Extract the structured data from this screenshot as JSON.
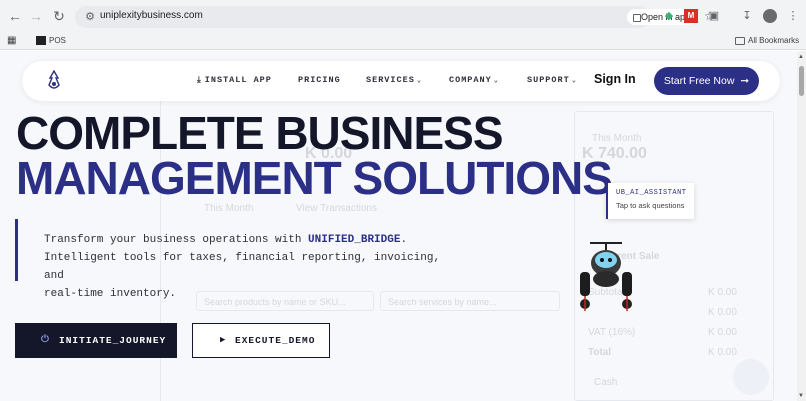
{
  "browser": {
    "url": "uniplexitybusiness.com",
    "open_in_app": "Open in app",
    "bookmark_pos": "POS",
    "all_bookmarks": "All Bookmarks"
  },
  "navbar": {
    "install": "INSTALL APP",
    "pricing": "PRICING",
    "services": "SERVICES",
    "company": "COMPANY",
    "support": "SUPPORT",
    "sign_in": "Sign In",
    "start": "Start Free Now"
  },
  "hero": {
    "line1": "COMPLETE BUSINESS",
    "line2": "MANAGEMENT SOLUTIONS",
    "desc_pre": "Transform your business operations with ",
    "desc_highlight": "UNIFIED_BRIDGE",
    "desc_post_1": ".",
    "desc_line2": "Intelligent tools for taxes, financial reporting, invoicing, and",
    "desc_line3": "real-time inventory.",
    "btn_initiate": "INITIATE_JOURNEY",
    "btn_demo": "EXECUTE_DEMO"
  },
  "assistant": {
    "title": "UB_AI_ASSISTANT",
    "subtitle": "Tap to ask questions"
  },
  "background": {
    "this_month_label": "This Month",
    "this_month_value": "K 740.00",
    "left_value": "K 0.00",
    "this_month_dropdown": "This Month",
    "view_transactions": "View Transactions",
    "current_sale": "Current Sale",
    "subtotal": "Subtotal",
    "vat_label": "VAT (16%)",
    "total_label": "Total",
    "zero_value": "K 0.00",
    "search_products": "Search products by name or SKU...",
    "search_services": "Search services by name...",
    "cash": "Cash"
  },
  "colors": {
    "accent": "#2b2f86",
    "dark": "#14172a"
  }
}
